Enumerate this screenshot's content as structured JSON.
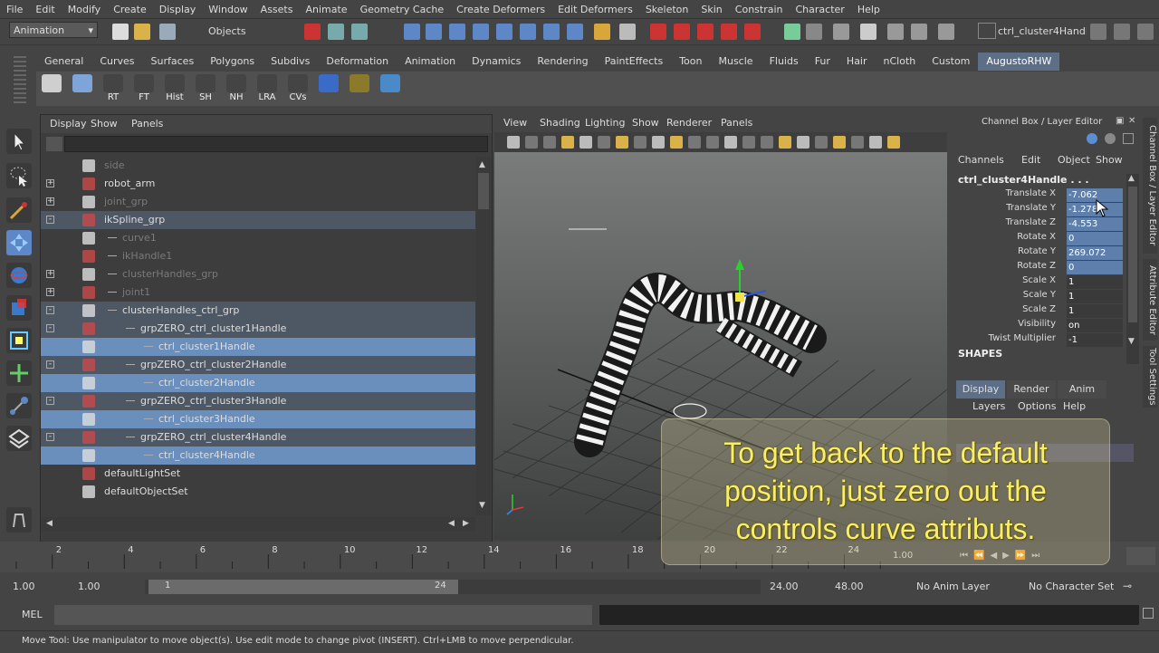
{
  "menubar": [
    "File",
    "Edit",
    "Modify",
    "Create",
    "Display",
    "Window",
    "Assets",
    "Animate",
    "Geometry Cache",
    "Create Deformers",
    "Edit Deformers",
    "Skeleton",
    "Skin",
    "Constrain",
    "Character",
    "Help"
  ],
  "status": {
    "menu_set": "Animation",
    "selection_mode": "Objects",
    "name_field": "ctrl_cluster4Handle"
  },
  "shelf_tabs": [
    "General",
    "Curves",
    "Surfaces",
    "Polygons",
    "Subdivs",
    "Deformation",
    "Animation",
    "Dynamics",
    "Rendering",
    "PaintEffects",
    "Toon",
    "Muscle",
    "Fluids",
    "Fur",
    "Hair",
    "nCloth",
    "Custom",
    "AugustoRHW"
  ],
  "shelf_active_tab": "AugustoRHW",
  "shelf_buttons": [
    "",
    "",
    "RT",
    "FT",
    "Hist",
    "SH",
    "NH",
    "LRA",
    "CVs",
    "",
    "",
    ""
  ],
  "outliner": {
    "menu": [
      "Display",
      "Show",
      "Panels"
    ],
    "items": [
      {
        "label": "side",
        "depth": 0,
        "dim": true,
        "expander": "",
        "state": ""
      },
      {
        "label": "robot_arm",
        "depth": 0,
        "dim": false,
        "expander": "+",
        "state": ""
      },
      {
        "label": "joint_grp",
        "depth": 0,
        "dim": true,
        "expander": "+",
        "state": ""
      },
      {
        "label": "ikSpline_grp",
        "depth": 0,
        "dim": false,
        "expander": "-",
        "state": "sel2"
      },
      {
        "label": "curve1",
        "depth": 1,
        "dim": true,
        "expander": "",
        "state": ""
      },
      {
        "label": "ikHandle1",
        "depth": 1,
        "dim": true,
        "expander": "",
        "state": ""
      },
      {
        "label": "clusterHandles_grp",
        "depth": 1,
        "dim": true,
        "expander": "+",
        "state": ""
      },
      {
        "label": "joint1",
        "depth": 1,
        "dim": true,
        "expander": "+",
        "state": ""
      },
      {
        "label": "clusterHandles_ctrl_grp",
        "depth": 1,
        "dim": false,
        "expander": "-",
        "state": "sel2"
      },
      {
        "label": "grpZERO_ctrl_cluster1Handle",
        "depth": 2,
        "dim": false,
        "expander": "-",
        "state": "sel2"
      },
      {
        "label": "ctrl_cluster1Handle",
        "depth": 3,
        "dim": false,
        "expander": "",
        "state": "sel"
      },
      {
        "label": "grpZERO_ctrl_cluster2Handle",
        "depth": 2,
        "dim": false,
        "expander": "-",
        "state": "sel2"
      },
      {
        "label": "ctrl_cluster2Handle",
        "depth": 3,
        "dim": false,
        "expander": "",
        "state": "sel"
      },
      {
        "label": "grpZERO_ctrl_cluster3Handle",
        "depth": 2,
        "dim": false,
        "expander": "-",
        "state": "sel2"
      },
      {
        "label": "ctrl_cluster3Handle",
        "depth": 3,
        "dim": false,
        "expander": "",
        "state": "sel"
      },
      {
        "label": "grpZERO_ctrl_cluster4Handle",
        "depth": 2,
        "dim": false,
        "expander": "-",
        "state": "sel2"
      },
      {
        "label": "ctrl_cluster4Handle",
        "depth": 3,
        "dim": false,
        "expander": "",
        "state": "sel"
      },
      {
        "label": "defaultLightSet",
        "depth": 0,
        "dim": false,
        "expander": "",
        "state": ""
      },
      {
        "label": "defaultObjectSet",
        "depth": 0,
        "dim": false,
        "expander": "",
        "state": ""
      }
    ]
  },
  "viewport": {
    "menu": [
      "View",
      "Shading",
      "Lighting",
      "Show",
      "Renderer",
      "Panels"
    ]
  },
  "channel_box": {
    "title": "Channel Box / Layer Editor",
    "menu": [
      "Channels",
      "Edit",
      "Object",
      "Show"
    ],
    "object": "ctrl_cluster4Handle . . .",
    "attributes": [
      {
        "name": "Translate X",
        "value": "-7.062",
        "hl": true
      },
      {
        "name": "Translate Y",
        "value": "-1.278",
        "hl": true
      },
      {
        "name": "Translate Z",
        "value": "-4.553",
        "hl": true
      },
      {
        "name": "Rotate X",
        "value": "0",
        "hl": true
      },
      {
        "name": "Rotate Y",
        "value": "269.072",
        "hl": true
      },
      {
        "name": "Rotate Z",
        "value": "0",
        "hl": true
      },
      {
        "name": "Scale X",
        "value": "1",
        "hl": false
      },
      {
        "name": "Scale Y",
        "value": "1",
        "hl": false
      },
      {
        "name": "Scale Z",
        "value": "1",
        "hl": false
      },
      {
        "name": "Visibility",
        "value": "on",
        "hl": false
      },
      {
        "name": "Twist Multiplier",
        "value": "-1",
        "hl": false
      }
    ],
    "shapes_label": "SHAPES",
    "layer_tabs": [
      "Display",
      "Render",
      "Anim"
    ],
    "layer_menu": [
      "Layers",
      "Options",
      "Help"
    ]
  },
  "side_tabs": [
    "Channel Box / Layer Editor",
    "Attribute Editor",
    "Tool Settings"
  ],
  "timeline": {
    "ticks": [
      "2",
      "4",
      "6",
      "8",
      "10",
      "12",
      "14",
      "16",
      "18",
      "20",
      "22",
      "24"
    ],
    "current": "1.00"
  },
  "range": {
    "start": "1.00",
    "start2": "1.00",
    "slider_start": "1",
    "slider_end": "24",
    "end": "24.00",
    "end2": "48.00",
    "anim_layer": "No Anim Layer",
    "char_set": "No Character Set"
  },
  "mel_label": "MEL",
  "help_line": "Move Tool: Use manipulator to move object(s). Use edit mode to change pivot (INSERT).  Ctrl+LMB to move perpendicular.",
  "overlay_text": [
    "To get back to the default",
    "position, just zero out the",
    "controls curve attributs."
  ]
}
